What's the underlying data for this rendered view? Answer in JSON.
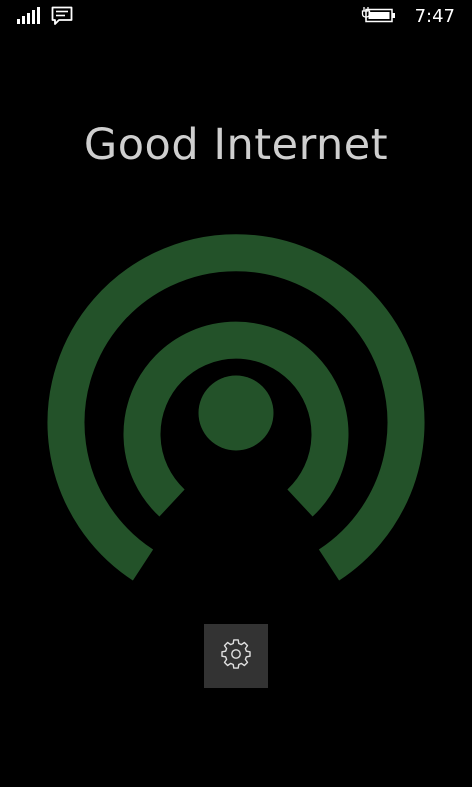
{
  "status_bar": {
    "signal_icon": "signal-bars-icon",
    "message_icon": "message-icon",
    "battery_icon": "battery-charging-icon",
    "time": "7:47"
  },
  "main": {
    "title": "Good Internet",
    "graphic_icon": "wifi-broadcast-icon",
    "accent_color": "#235229",
    "settings_icon": "gear-icon"
  }
}
